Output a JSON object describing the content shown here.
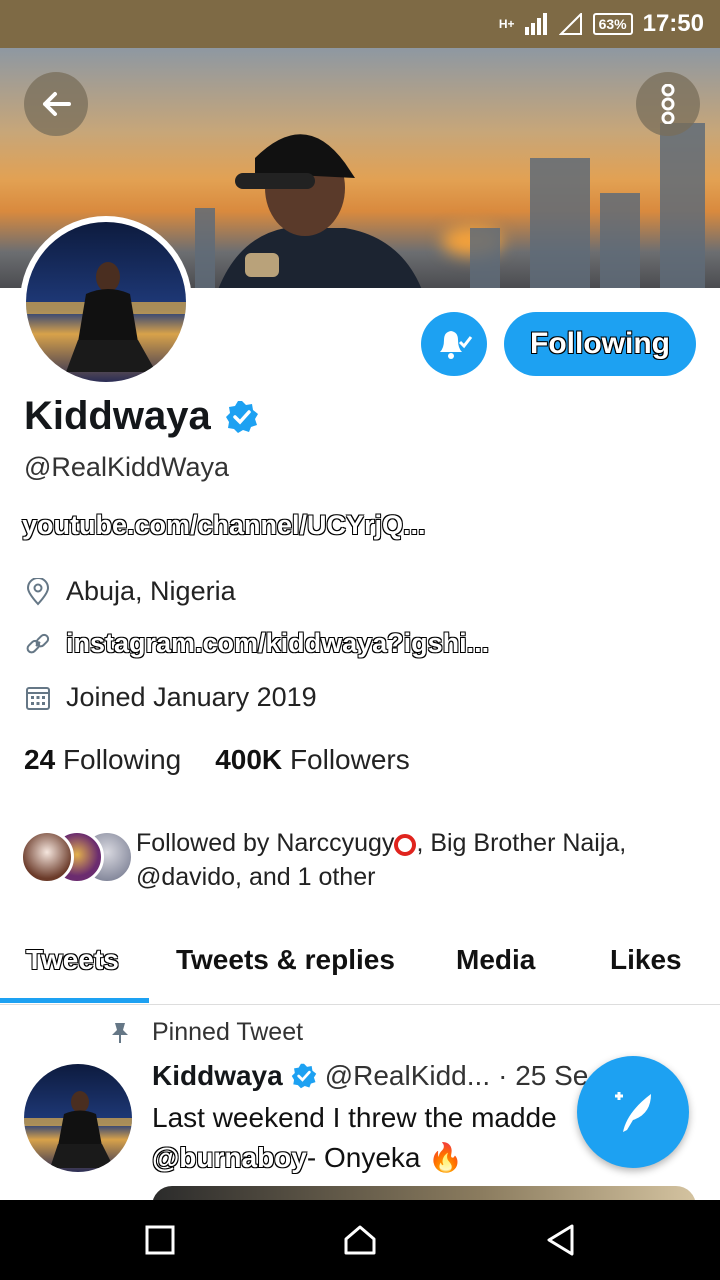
{
  "status_bar": {
    "signal": "H+",
    "battery": "63%",
    "time": "17:50"
  },
  "profile": {
    "name": "Kiddwaya",
    "handle": "@RealKiddWaya",
    "bio_link": "youtube.com/channel/UCYrjQ...",
    "location": "Abuja, Nigeria",
    "website": "instagram.com/kiddwaya?igshi...",
    "joined": "Joined January 2019",
    "following_count": "24",
    "following_label": "Following",
    "followers_count": "400K",
    "followers_label": "Followers",
    "followed_by_prefix": "Followed by Narccyugy",
    "followed_by_suffix": ", Big Brother Naija, @davido, and 1 other"
  },
  "actions": {
    "follow_label": "Following"
  },
  "tabs": [
    {
      "label": "Tweets"
    },
    {
      "label": "Tweets & replies"
    },
    {
      "label": "Media"
    },
    {
      "label": "Likes"
    }
  ],
  "pinned_tweet": {
    "label": "Pinned Tweet",
    "name": "Kiddwaya",
    "handle": "@RealKidd...",
    "date": "· 25 Se",
    "text_line1": "Last weekend I threw the madde",
    "mention": "@burnaboy",
    "text_line2_rest": "- Onyeka 🔥"
  },
  "colors": {
    "accent": "#1da1f2",
    "status_bar": "#7e6a45",
    "nav_bar": "#000000"
  },
  "icons": [
    "back-arrow-icon",
    "more-vertical-icon",
    "bell-check-icon",
    "verified-badge-icon",
    "location-pin-icon",
    "link-icon",
    "calendar-icon",
    "pin-icon",
    "compose-tweet-icon",
    "square-nav-icon",
    "home-nav-icon",
    "back-nav-icon"
  ]
}
